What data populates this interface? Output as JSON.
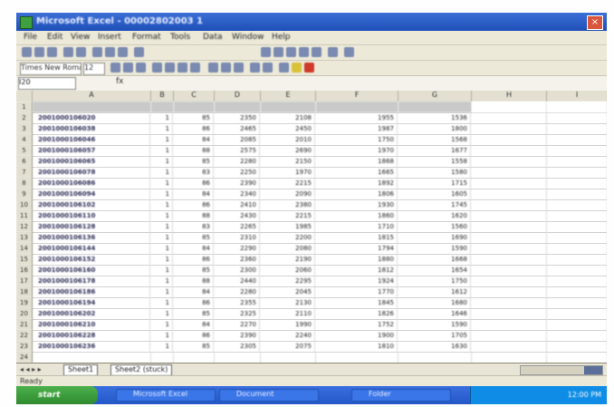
{
  "window": {
    "title": "Microsoft Excel - 00002802003 1",
    "close_glyph": "×"
  },
  "menubar": {
    "items": [
      "File",
      "Edit",
      "View",
      "Insert",
      "Format",
      "Tools",
      "Data",
      "Window",
      "Help"
    ]
  },
  "toolbar": {
    "font_name": "Times New Roman",
    "font_size": "12"
  },
  "formula_bar": {
    "name_box": "I20",
    "fx": "fx"
  },
  "columns": [
    "A",
    "B",
    "C",
    "D",
    "E",
    "F",
    "G",
    "H",
    "I"
  ],
  "table": {
    "headers": [
      "",
      "",
      "",
      "",
      "",
      "",
      ""
    ],
    "rows": [
      [
        "2001000106020",
        "1",
        "85",
        "2350",
        "2108",
        "1955",
        "1536"
      ],
      [
        "2001000106038",
        "1",
        "86",
        "2465",
        "2450",
        "1987",
        "1800"
      ],
      [
        "2001000106046",
        "1",
        "84",
        "2085",
        "2010",
        "1750",
        "1568"
      ],
      [
        "2001000106057",
        "1",
        "88",
        "2575",
        "2690",
        "1970",
        "1677"
      ],
      [
        "2001000106065",
        "1",
        "85",
        "2280",
        "2150",
        "1868",
        "1558"
      ],
      [
        "2001000106078",
        "1",
        "83",
        "2250",
        "1970",
        "1665",
        "1580"
      ],
      [
        "2001000106086",
        "1",
        "86",
        "2390",
        "2215",
        "1892",
        "1715"
      ],
      [
        "2001000106094",
        "1",
        "84",
        "2340",
        "2090",
        "1806",
        "1605"
      ],
      [
        "2001000106102",
        "1",
        "86",
        "2410",
        "2380",
        "1930",
        "1745"
      ],
      [
        "2001000106110",
        "1",
        "88",
        "2430",
        "2215",
        "1860",
        "1620"
      ],
      [
        "2001000106128",
        "1",
        "83",
        "2265",
        "1985",
        "1710",
        "1560"
      ],
      [
        "2001000106136",
        "1",
        "85",
        "2310",
        "2200",
        "1815",
        "1690"
      ],
      [
        "2001000106144",
        "1",
        "84",
        "2290",
        "2080",
        "1794",
        "1590"
      ],
      [
        "2001000106152",
        "1",
        "86",
        "2360",
        "2190",
        "1880",
        "1668"
      ],
      [
        "2001000106160",
        "1",
        "85",
        "2300",
        "2060",
        "1812",
        "1654"
      ],
      [
        "2001000106178",
        "1",
        "88",
        "2440",
        "2295",
        "1924",
        "1750"
      ],
      [
        "2001000106186",
        "1",
        "84",
        "2280",
        "2045",
        "1770",
        "1612"
      ],
      [
        "2001000106194",
        "1",
        "86",
        "2355",
        "2130",
        "1845",
        "1680"
      ],
      [
        "2001000106202",
        "1",
        "85",
        "2325",
        "2110",
        "1826",
        "1646"
      ],
      [
        "2001000106210",
        "1",
        "84",
        "2270",
        "1990",
        "1752",
        "1590"
      ],
      [
        "2001000106228",
        "1",
        "86",
        "2390",
        "2240",
        "1900",
        "1705"
      ],
      [
        "2001000106236",
        "1",
        "85",
        "2305",
        "2075",
        "1810",
        "1630"
      ]
    ]
  },
  "sheet_tabs": {
    "nav": "◂ ◂ ▸ ▸",
    "tabs": [
      "Sheet1",
      "Sheet2 (stuck)"
    ]
  },
  "status": {
    "text": "Ready"
  },
  "taskbar": {
    "start": "start",
    "buttons": [
      "Microsoft Excel",
      "Document",
      "Folder"
    ],
    "time": "12:00 PM"
  }
}
